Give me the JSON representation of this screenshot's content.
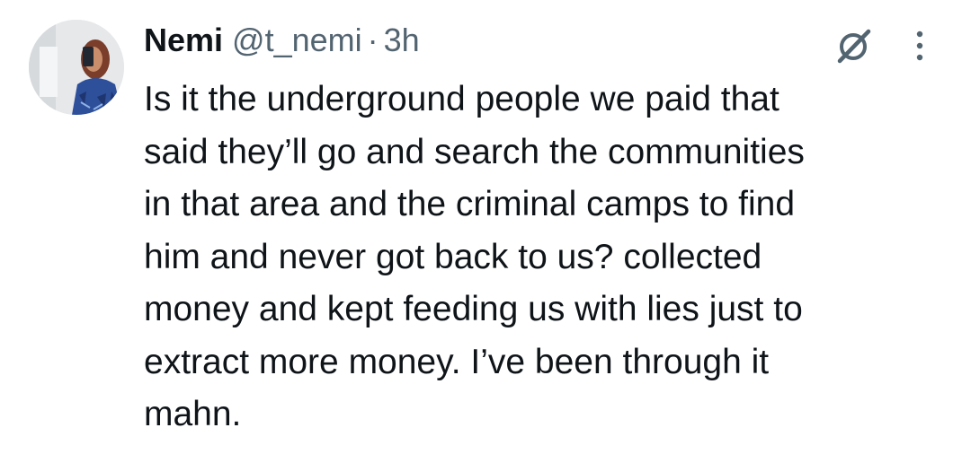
{
  "tweet": {
    "author_name": "Nemi",
    "handle": "@t_nemi",
    "separator": "·",
    "time": "3h",
    "text_lines": [
      "Is it the underground people we paid that",
      "said they’ll go and search the communities",
      "in that area and the criminal camps to find",
      "him and never got back to us? collected",
      "money and kept feeding us with lies just to",
      "extract more money. I’ve been through it",
      "mahn."
    ]
  },
  "icons": {
    "avatar": "profile-photo",
    "grok": "grok-slash-circle-icon",
    "more": "vertical-ellipsis-icon"
  },
  "colors": {
    "primary_text": "#0f1419",
    "secondary_text": "#536471",
    "background": "#ffffff"
  }
}
